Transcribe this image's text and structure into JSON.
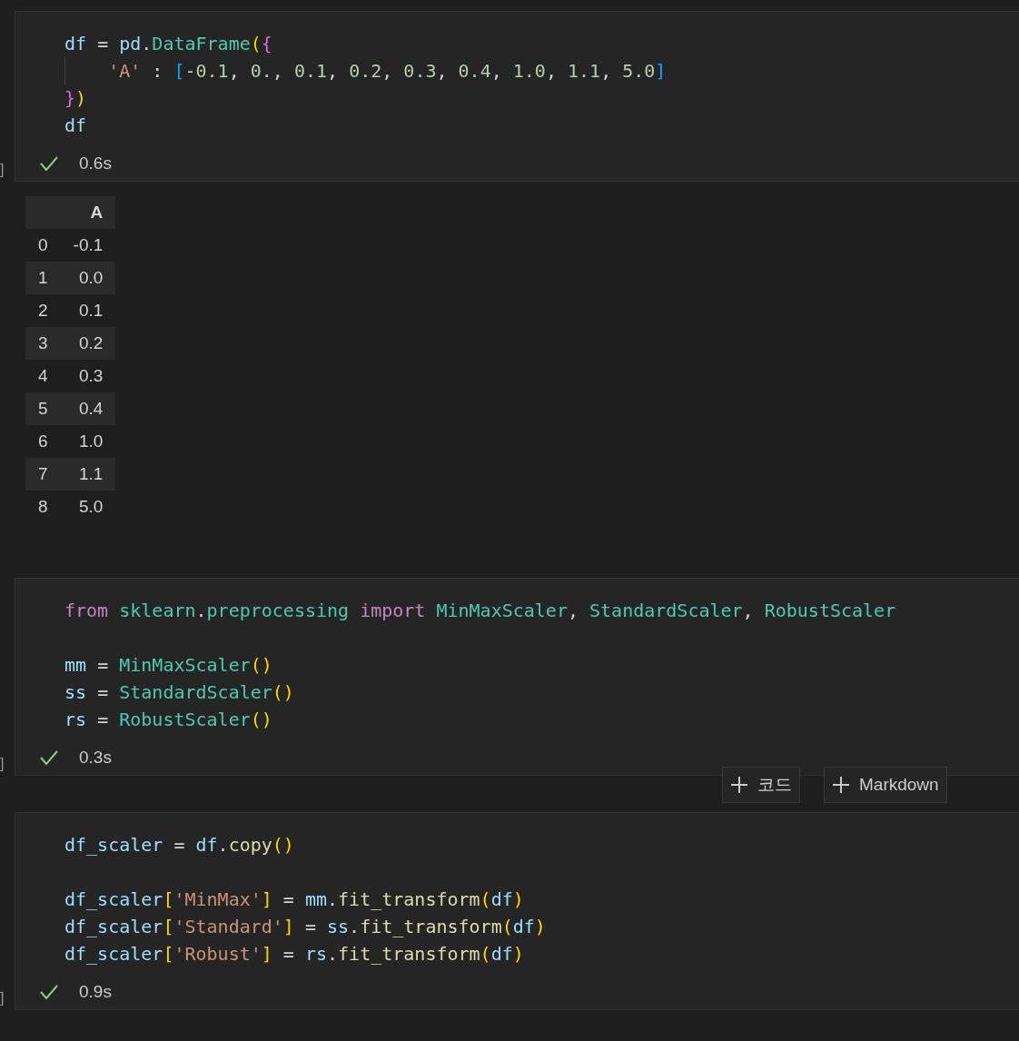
{
  "cells": [
    {
      "gutter": "]",
      "lines": [
        {
          "tokens": [
            {
              "kind": "var",
              "text": "df"
            },
            {
              "kind": "plain",
              "text": " = "
            },
            {
              "kind": "var",
              "text": "pd"
            },
            {
              "kind": "plain",
              "text": "."
            },
            {
              "kind": "class",
              "text": "DataFrame"
            },
            {
              "kind": "bracket1",
              "text": "("
            },
            {
              "kind": "bracket2",
              "text": "{"
            }
          ]
        },
        {
          "indent": true,
          "tokens": [
            {
              "kind": "str",
              "text": "'A'"
            },
            {
              "kind": "plain",
              "text": " : "
            },
            {
              "kind": "bracket3",
              "text": "["
            },
            {
              "kind": "plain",
              "text": "-"
            },
            {
              "kind": "num",
              "text": "0.1"
            },
            {
              "kind": "plain",
              "text": ", "
            },
            {
              "kind": "num",
              "text": "0."
            },
            {
              "kind": "plain",
              "text": ", "
            },
            {
              "kind": "num",
              "text": "0.1"
            },
            {
              "kind": "plain",
              "text": ", "
            },
            {
              "kind": "num",
              "text": "0.2"
            },
            {
              "kind": "plain",
              "text": ", "
            },
            {
              "kind": "num",
              "text": "0.3"
            },
            {
              "kind": "plain",
              "text": ", "
            },
            {
              "kind": "num",
              "text": "0.4"
            },
            {
              "kind": "plain",
              "text": ", "
            },
            {
              "kind": "num",
              "text": "1.0"
            },
            {
              "kind": "plain",
              "text": ", "
            },
            {
              "kind": "num",
              "text": "1.1"
            },
            {
              "kind": "plain",
              "text": ", "
            },
            {
              "kind": "num",
              "text": "5.0"
            },
            {
              "kind": "bracket3",
              "text": "]"
            }
          ]
        },
        {
          "tokens": [
            {
              "kind": "bracket2",
              "text": "}"
            },
            {
              "kind": "bracket1",
              "text": ")"
            }
          ]
        },
        {
          "tokens": [
            {
              "kind": "var",
              "text": "df"
            }
          ]
        }
      ],
      "status": {
        "ok": true,
        "time": "0.6s"
      },
      "output": {
        "columns": [
          "",
          "A"
        ],
        "rows": [
          [
            "0",
            "-0.1"
          ],
          [
            "1",
            "0.0"
          ],
          [
            "2",
            "0.1"
          ],
          [
            "3",
            "0.2"
          ],
          [
            "4",
            "0.3"
          ],
          [
            "5",
            "0.4"
          ],
          [
            "6",
            "1.0"
          ],
          [
            "7",
            "1.1"
          ],
          [
            "8",
            "5.0"
          ]
        ]
      }
    },
    {
      "gutter": "]",
      "lines": [
        {
          "tokens": [
            {
              "kind": "kw",
              "text": "from "
            },
            {
              "kind": "class",
              "text": "sklearn"
            },
            {
              "kind": "plain",
              "text": "."
            },
            {
              "kind": "class",
              "text": "preprocessing "
            },
            {
              "kind": "kw",
              "text": "import "
            },
            {
              "kind": "class",
              "text": "MinMaxScaler"
            },
            {
              "kind": "plain",
              "text": ", "
            },
            {
              "kind": "class",
              "text": "StandardScaler"
            },
            {
              "kind": "plain",
              "text": ", "
            },
            {
              "kind": "class",
              "text": "RobustScaler"
            }
          ]
        },
        {
          "gap_before": true,
          "tokens": [
            {
              "kind": "var",
              "text": "mm"
            },
            {
              "kind": "plain",
              "text": " = "
            },
            {
              "kind": "class",
              "text": "MinMaxScaler"
            },
            {
              "kind": "bracket1",
              "text": "()"
            }
          ]
        },
        {
          "tokens": [
            {
              "kind": "var",
              "text": "ss"
            },
            {
              "kind": "plain",
              "text": " = "
            },
            {
              "kind": "class",
              "text": "StandardScaler"
            },
            {
              "kind": "bracket1",
              "text": "()"
            }
          ]
        },
        {
          "tokens": [
            {
              "kind": "var",
              "text": "rs"
            },
            {
              "kind": "plain",
              "text": " = "
            },
            {
              "kind": "class",
              "text": "RobustScaler"
            },
            {
              "kind": "bracket1",
              "text": "()"
            }
          ]
        }
      ],
      "status": {
        "ok": true,
        "time": "0.3s"
      },
      "add_buttons": [
        "코드",
        "Markdown"
      ]
    },
    {
      "gutter": "]",
      "lines": [
        {
          "tokens": [
            {
              "kind": "var",
              "text": "df_scaler"
            },
            {
              "kind": "plain",
              "text": " = "
            },
            {
              "kind": "var",
              "text": "df"
            },
            {
              "kind": "plain",
              "text": "."
            },
            {
              "kind": "func",
              "text": "copy"
            },
            {
              "kind": "bracket1",
              "text": "()"
            }
          ]
        },
        {
          "gap_before": true,
          "tokens": [
            {
              "kind": "var",
              "text": "df_scaler"
            },
            {
              "kind": "bracket1",
              "text": "["
            },
            {
              "kind": "str",
              "text": "'MinMax'"
            },
            {
              "kind": "bracket1",
              "text": "]"
            },
            {
              "kind": "plain",
              "text": " = "
            },
            {
              "kind": "var",
              "text": "mm"
            },
            {
              "kind": "plain",
              "text": "."
            },
            {
              "kind": "func",
              "text": "fit_transform"
            },
            {
              "kind": "bracket1",
              "text": "("
            },
            {
              "kind": "var",
              "text": "df"
            },
            {
              "kind": "bracket1",
              "text": ")"
            }
          ]
        },
        {
          "tokens": [
            {
              "kind": "var",
              "text": "df_scaler"
            },
            {
              "kind": "bracket1",
              "text": "["
            },
            {
              "kind": "str",
              "text": "'Standard'"
            },
            {
              "kind": "bracket1",
              "text": "]"
            },
            {
              "kind": "plain",
              "text": " = "
            },
            {
              "kind": "var",
              "text": "ss"
            },
            {
              "kind": "plain",
              "text": "."
            },
            {
              "kind": "func",
              "text": "fit_transform"
            },
            {
              "kind": "bracket1",
              "text": "("
            },
            {
              "kind": "var",
              "text": "df"
            },
            {
              "kind": "bracket1",
              "text": ")"
            }
          ]
        },
        {
          "tokens": [
            {
              "kind": "var",
              "text": "df_scaler"
            },
            {
              "kind": "bracket1",
              "text": "["
            },
            {
              "kind": "str",
              "text": "'Robust'"
            },
            {
              "kind": "bracket1",
              "text": "]"
            },
            {
              "kind": "plain",
              "text": " = "
            },
            {
              "kind": "var",
              "text": "rs"
            },
            {
              "kind": "plain",
              "text": "."
            },
            {
              "kind": "func",
              "text": "fit_transform"
            },
            {
              "kind": "bracket1",
              "text": "("
            },
            {
              "kind": "var",
              "text": "df"
            },
            {
              "kind": "bracket1",
              "text": ")"
            }
          ]
        }
      ],
      "status": {
        "ok": true,
        "time": "0.9s"
      }
    }
  ]
}
